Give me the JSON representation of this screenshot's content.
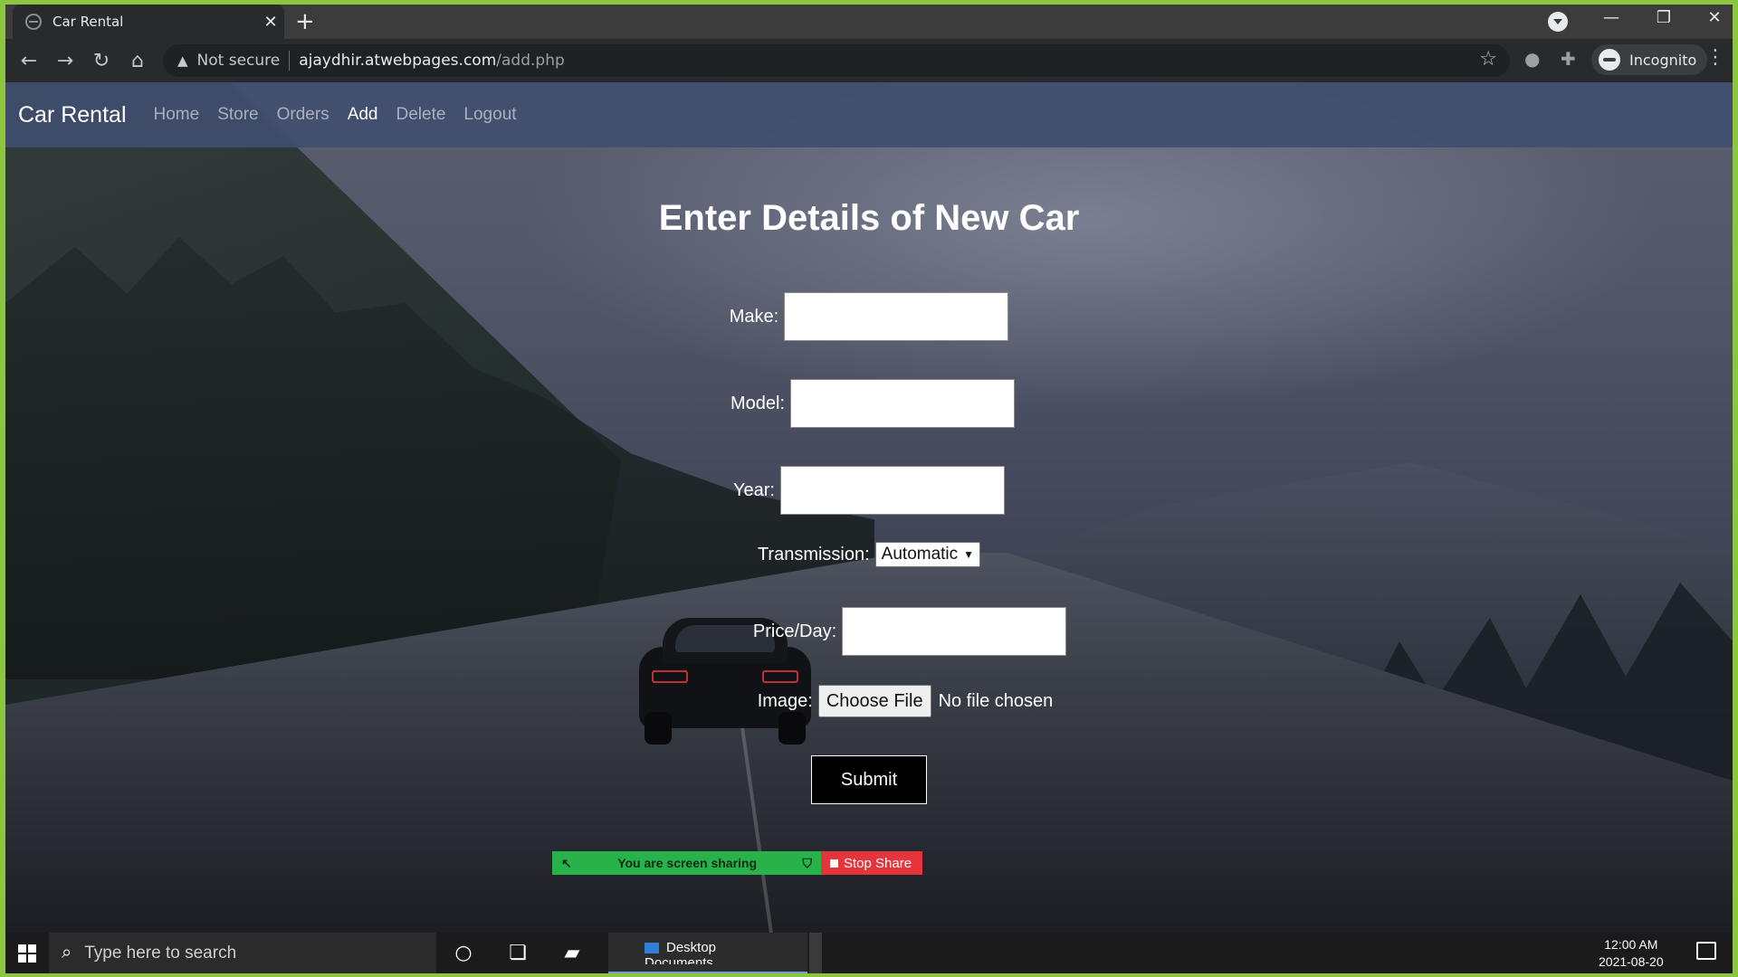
{
  "browser": {
    "tab_title": "Car Rental",
    "tab_close": "✕",
    "new_tab": "+",
    "security_label": "Not secure",
    "url_host": "ajaydhir.atwebpages.com",
    "url_path": "/add.php",
    "profile_label": "Incognito"
  },
  "nav": {
    "brand": "Car Rental",
    "links": [
      {
        "label": "Home",
        "active": false
      },
      {
        "label": "Store",
        "active": false
      },
      {
        "label": "Orders",
        "active": false
      },
      {
        "label": "Add",
        "active": true
      },
      {
        "label": "Delete",
        "active": false
      },
      {
        "label": "Logout",
        "active": false
      }
    ]
  },
  "form": {
    "title": "Enter Details of New Car",
    "make_label": "Make:",
    "make_value": "",
    "model_label": "Model:",
    "model_value": "",
    "year_label": "Year:",
    "year_value": "",
    "transmission_label": "Transmission:",
    "transmission_value": "Automatic",
    "price_label": "Price/Day:",
    "price_value": "",
    "image_label": "Image:",
    "file_button": "Choose File",
    "file_status": "No file chosen",
    "submit_label": "Submit"
  },
  "share_bar": {
    "status": "You are screen sharing",
    "stop_label": "Stop Share",
    "status_color": "#28b34a",
    "stop_color": "#e5343c"
  },
  "taskbar": {
    "search_placeholder": "Type here to search",
    "app_line1": "Desktop",
    "app_line2": "Documents",
    "time": "12:00 AM",
    "date": "2021-08-20"
  },
  "colors": {
    "navbar": "#404e6e",
    "frame": "#8cc63f"
  }
}
